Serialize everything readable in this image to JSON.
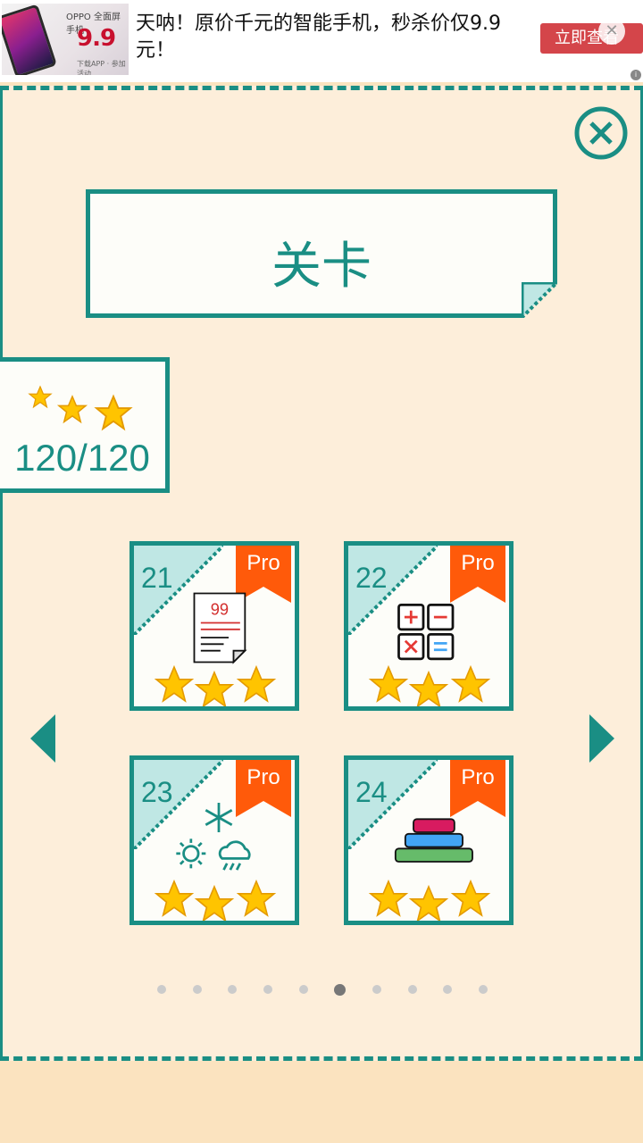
{
  "ad": {
    "brand": "OPPO 全面屏手机",
    "price": "9.9",
    "price_note": "下载APP · 参加活动",
    "text": "天呐！原价千元的智能手机，秒杀价仅9.9元！",
    "cta": "立即查看",
    "close": "✕"
  },
  "header": {
    "title": "关卡"
  },
  "stars_summary": {
    "count": "120/120"
  },
  "levels": [
    {
      "number": "21",
      "badge": "Pro",
      "icon": "document-99-icon",
      "stars": 3
    },
    {
      "number": "22",
      "badge": "Pro",
      "icon": "calculator-ops-icon",
      "stars": 3
    },
    {
      "number": "23",
      "badge": "Pro",
      "icon": "weather-icon",
      "stars": 3
    },
    {
      "number": "24",
      "badge": "Pro",
      "icon": "tower-of-hanoi-icon",
      "stars": 3
    }
  ],
  "doc_icon_text": "99",
  "pagination": {
    "total": 10,
    "active_index": 5
  },
  "colors": {
    "teal": "#1a8e84",
    "panel": "#fdeeda",
    "ribbon": "#ff5a0a",
    "star": "#ffc400"
  }
}
